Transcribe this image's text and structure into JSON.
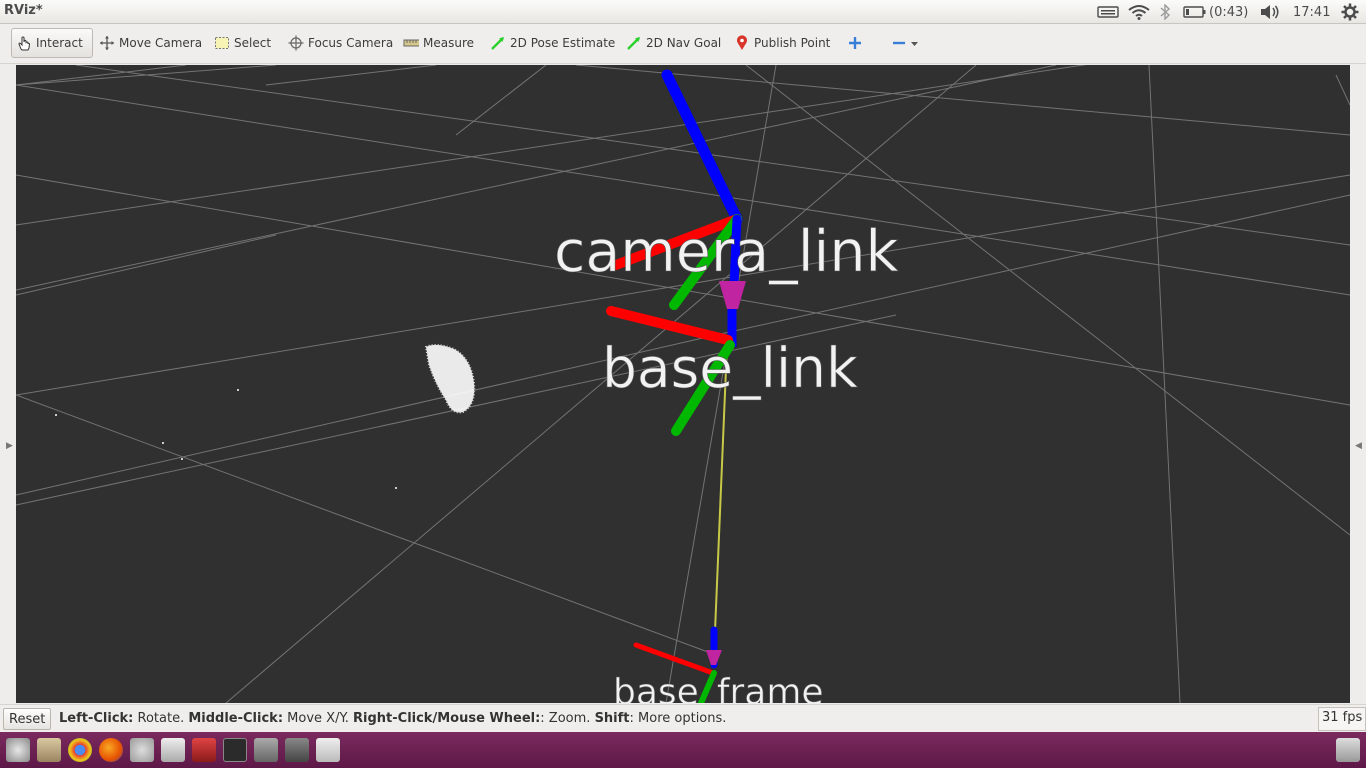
{
  "window": {
    "title": "RViz*"
  },
  "tray": {
    "battery": "(0:43)",
    "clock": "17:41"
  },
  "toolbar": {
    "interact": "Interact",
    "move_camera": "Move Camera",
    "select": "Select",
    "focus_camera": "Focus Camera",
    "measure": "Measure",
    "pose_estimate": "2D Pose Estimate",
    "nav_goal": "2D Nav Goal",
    "publish_point": "Publish Point"
  },
  "viewport": {
    "frames": [
      "camera_link",
      "base_link",
      "base_frame"
    ]
  },
  "statusbar": {
    "reset": "Reset",
    "help_left_key": "Left-Click:",
    "help_left_val": " Rotate. ",
    "help_mid_key": "Middle-Click:",
    "help_mid_val": " Move X/Y. ",
    "help_right_key": "Right-Click/Mouse Wheel:",
    "help_right_val": ": Zoom. ",
    "help_shift_key": "Shift",
    "help_shift_val": ": More options.",
    "fps": "31 fps"
  },
  "colors": {
    "launcher": "#5d1848",
    "viewport_bg": "#303030",
    "axis_x": "#ff0000",
    "axis_y": "#00c000",
    "axis_z": "#0000ff",
    "connector": "#d4d444"
  }
}
